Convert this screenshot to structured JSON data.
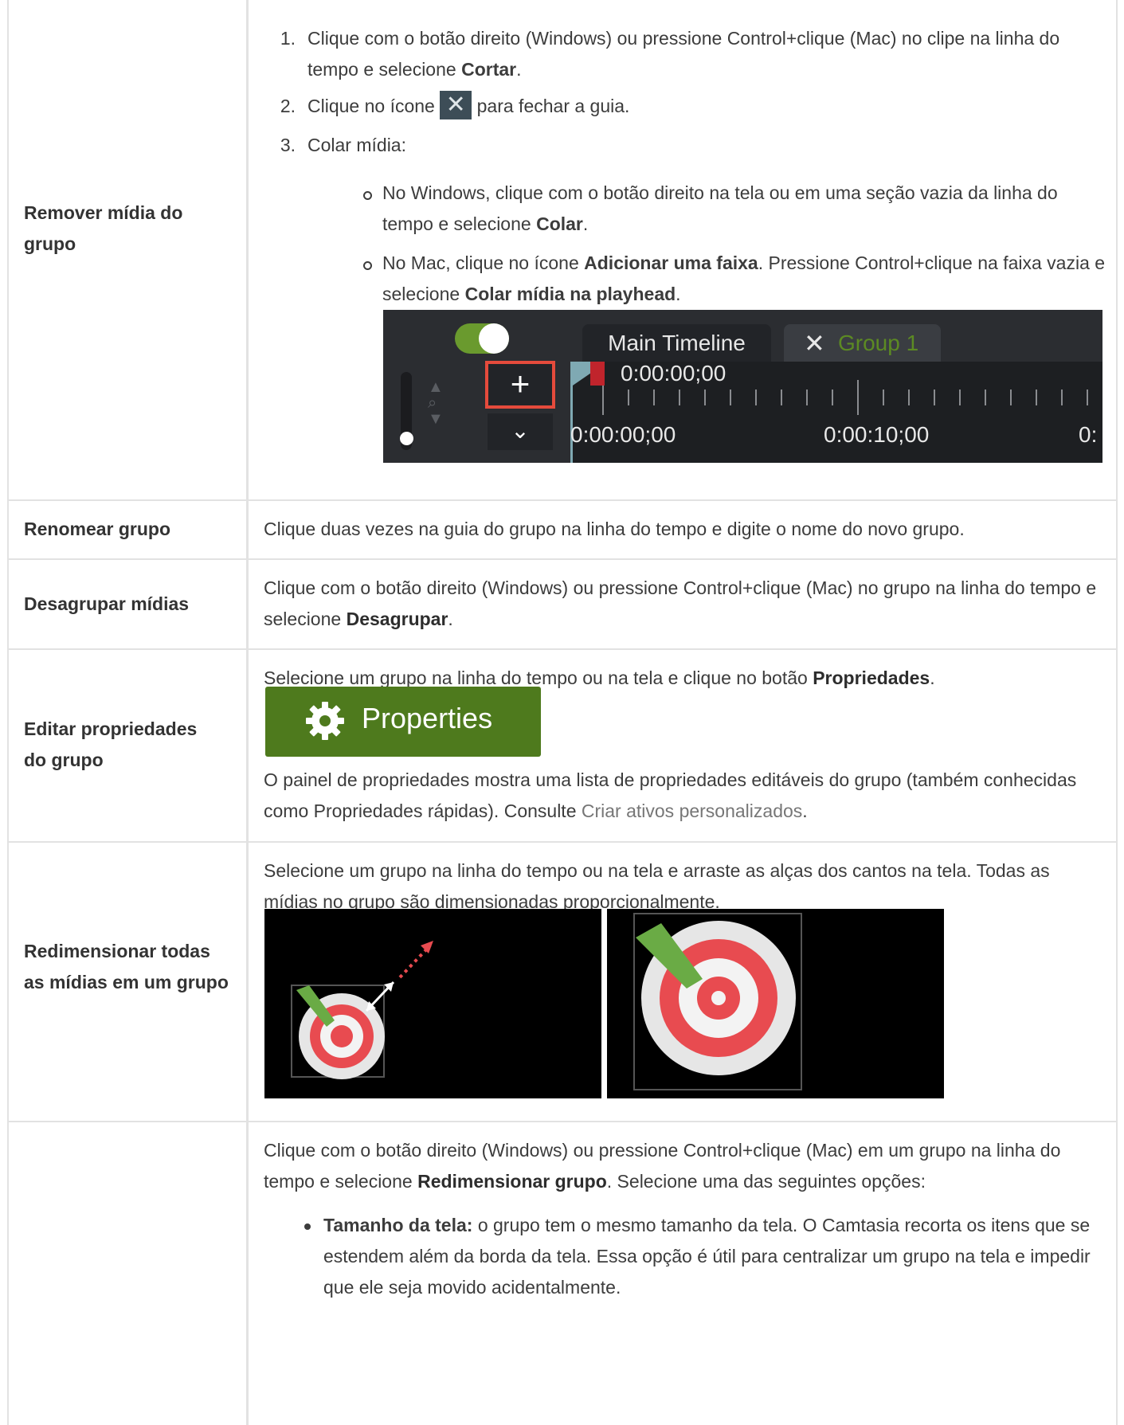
{
  "rows": [
    {
      "label": "Remover mídia do grupo",
      "steps": [
        {
          "num": "1.",
          "pre": "Clique com o botão direito (Windows) ou pressione Control+clique (Mac) no clipe na linha do tempo e selecione ",
          "bold": "Cortar",
          "post": "."
        },
        {
          "num": "2.",
          "pre": "Clique no ícone ",
          "post": " para fechar a guia."
        },
        {
          "num": "3.",
          "text": "Colar mídia:"
        }
      ],
      "sub_items": [
        {
          "pre": "No Windows, clique com o botão direito na tela ou em uma seção vazia da linha do tempo e selecione ",
          "bold": "Colar",
          "post": "."
        },
        {
          "pre": "No Mac, clique no ícone ",
          "bold": "Adicionar uma faixa",
          "mid": ". Pressione Control+clique na faixa vazia e selecione ",
          "bold2": "Colar mídia na playhead",
          "post": "."
        }
      ],
      "timeline": {
        "tab_main": "Main Timeline",
        "tab_group": "Group 1",
        "playhead_time": "0:00:00;00",
        "ruler_labels": [
          "0:00:00;00",
          "0:00:10;00",
          "0:"
        ]
      }
    },
    {
      "label": "Renomear grupo",
      "text": "Clique duas vezes na guia do grupo na linha do tempo e digite o nome do novo grupo."
    },
    {
      "label": "Desagrupar mídias",
      "pre": "Clique com o botão direito (Windows) ou pressione Control+clique (Mac) no grupo na linha do tempo e selecione ",
      "bold": "Desagrupar",
      "post": "."
    },
    {
      "label": "Editar propriedades do grupo",
      "pre": "Selecione um grupo na linha do tempo ou na tela e clique no botão ",
      "bold": "Propriedades",
      "post": ".",
      "button_label": "Properties",
      "after_pre": "O painel de propriedades mostra uma lista de propriedades editáveis do grupo (também conhecidas como Propriedades rápidas). Consulte ",
      "link": "Criar ativos personalizados",
      "after_post": "."
    },
    {
      "label": "Redimensionar todas as mídias em um grupo",
      "text": "Selecione um grupo na linha do tempo ou na tela e arraste as alças dos cantos na tela. Todas as mídias no grupo são dimensionadas proporcionalmente."
    },
    {
      "label": "",
      "pre": "Clique com o botão direito (Windows) ou pressione Control+clique (Mac) em um grupo na linha do tempo e selecione ",
      "bold": "Redimensionar grupo",
      "post": ". Selecione uma das seguintes opções:",
      "bullet_bold": "Tamanho da tela:",
      "bullet_text": " o grupo tem o mesmo tamanho da tela. O Camtasia recorta os itens que se estendem além da borda da tela. Essa opção é útil para centralizar um grupo na tela e impedir que ele seja movido acidentalmente."
    }
  ],
  "colors": {
    "border": "#e2e2e2",
    "properties_button": "#4e7a1d",
    "group_tab_text": "#5c8a23",
    "highlight_box": "#e54b3c"
  }
}
